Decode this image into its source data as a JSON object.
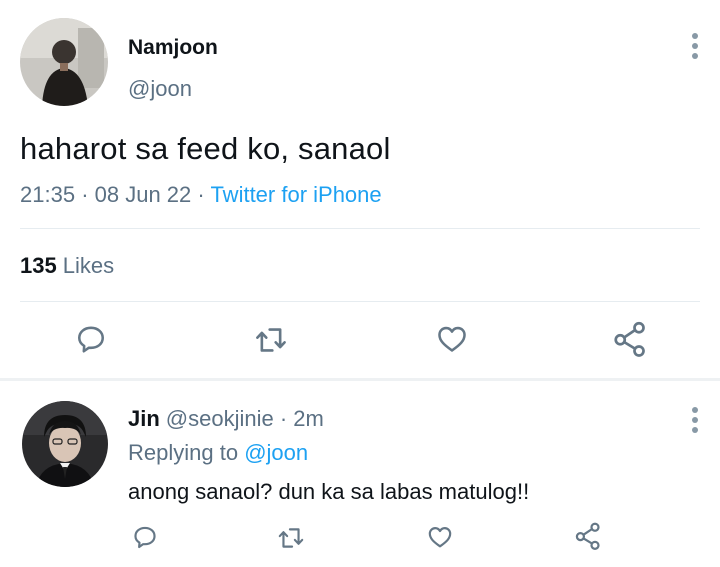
{
  "tweet": {
    "author_name": "Namjoon",
    "author_handle": "@joon",
    "text": "haharot sa feed ko, sanaol",
    "time": "21:35",
    "date": "08 Jun 22",
    "source": "Twitter for iPhone",
    "likes_count": "135",
    "likes_label": "Likes"
  },
  "reply": {
    "author_name": "Jin",
    "author_handle": "@seokjinie",
    "age": "2m",
    "replying_prefix": "Replying to",
    "replying_handle": "@joon",
    "text": "anong sanaol? dun ka sa labas matulog!!"
  },
  "icons": {
    "reply": "reply-bubble-icon",
    "retweet": "retweet-icon",
    "like": "heart-icon",
    "share": "share-icon",
    "more": "more-vertical-icon"
  },
  "colors": {
    "link": "#1da1f2",
    "secondary_text": "#5b7083",
    "primary_text": "#0f1419",
    "icon": "#657786"
  }
}
